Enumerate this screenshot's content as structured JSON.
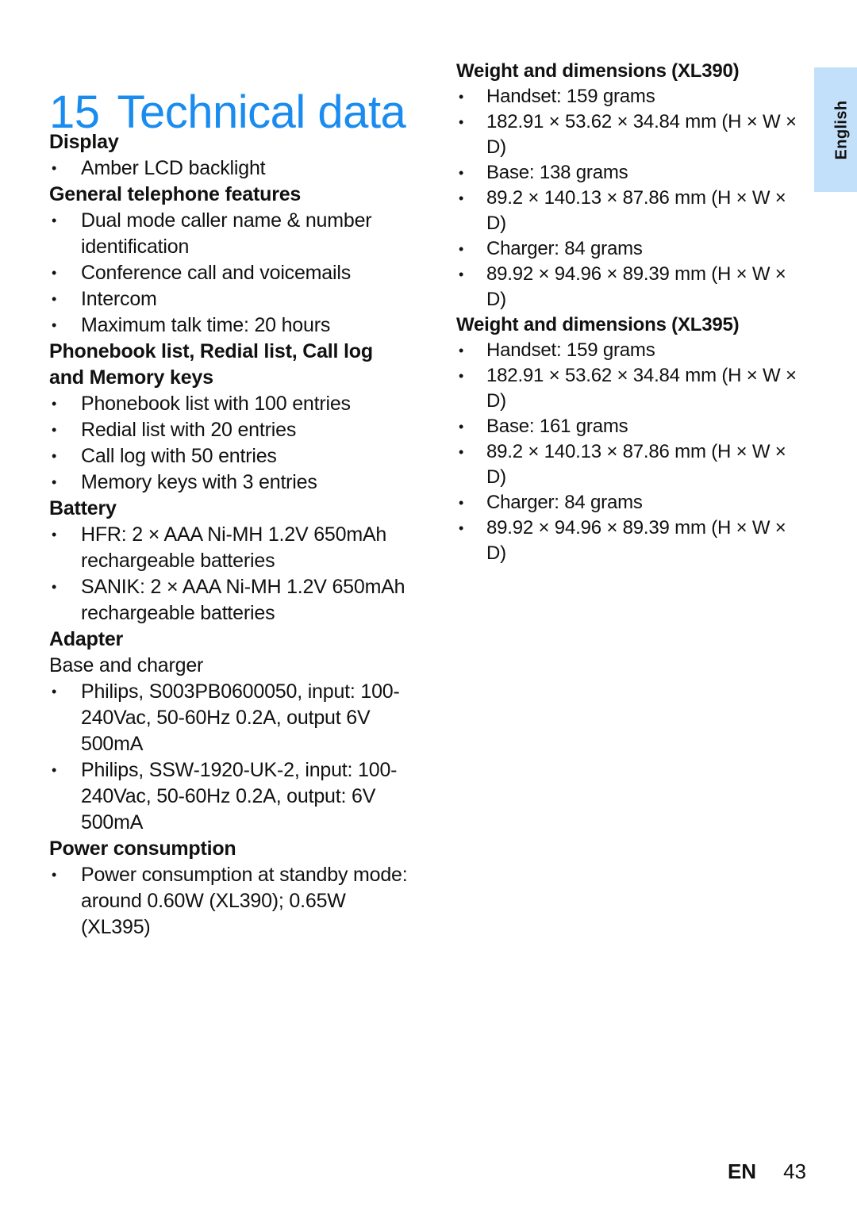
{
  "document": {
    "chapter_number": "15",
    "chapter_title": "Technical data",
    "title_color": "#1a8cf0"
  },
  "side_tab": {
    "label": "English",
    "background": "#c3e0fb"
  },
  "left_column": {
    "display": {
      "heading": "Display",
      "items": [
        "Amber LCD backlight"
      ]
    },
    "general_features": {
      "heading": "General telephone features",
      "items": [
        "Dual mode caller name & number identification",
        "Conference call and voicemails",
        "Intercom",
        "Maximum talk time: 20 hours"
      ]
    },
    "lists_and_keys": {
      "heading": "Phonebook list, Redial list, Call log and Memory keys",
      "items": [
        "Phonebook list with 100 entries",
        "Redial list with 20 entries",
        "Call log with 50 entries",
        "Memory keys with 3 entries"
      ]
    },
    "battery": {
      "heading": "Battery",
      "items": [
        "HFR: 2 × AAA Ni-MH 1.2V 650mAh rechargeable batteries",
        "SANIK: 2 × AAA Ni-MH 1.2V 650mAh rechargeable batteries"
      ]
    },
    "adapter": {
      "heading": "Adapter",
      "subheading": "Base and charger",
      "items": [
        "Philips, S003PB0600050, input: 100-240Vac, 50-60Hz 0.2A, output 6V 500mA",
        "Philips, SSW-1920-UK-2, input: 100-240Vac, 50-60Hz 0.2A, output: 6V 500mA"
      ]
    },
    "power_consumption": {
      "heading": "Power consumption",
      "items": [
        "Power consumption at standby mode: around 0.60W (XL390); 0.65W (XL395)"
      ]
    }
  },
  "right_column": {
    "xl390": {
      "heading": "Weight and dimensions (XL390)",
      "items": [
        "Handset: 159 grams",
        "182.91 × 53.62 × 34.84 mm (H × W × D)",
        "Base: 138 grams",
        "89.2 × 140.13 × 87.86 mm (H × W × D)",
        "Charger: 84 grams",
        "89.92 × 94.96 × 89.39 mm (H × W × D)"
      ]
    },
    "xl395": {
      "heading": "Weight and dimensions (XL395)",
      "items": [
        "Handset: 159 grams",
        "182.91 × 53.62 × 34.84 mm (H × W × D)",
        "Base: 161 grams",
        "89.2 × 140.13 × 87.86 mm (H × W × D)",
        "Charger: 84 grams",
        "89.92 × 94.96 × 89.39 mm (H × W × D)"
      ]
    }
  },
  "footer": {
    "language_code": "EN",
    "page_number": "43"
  }
}
